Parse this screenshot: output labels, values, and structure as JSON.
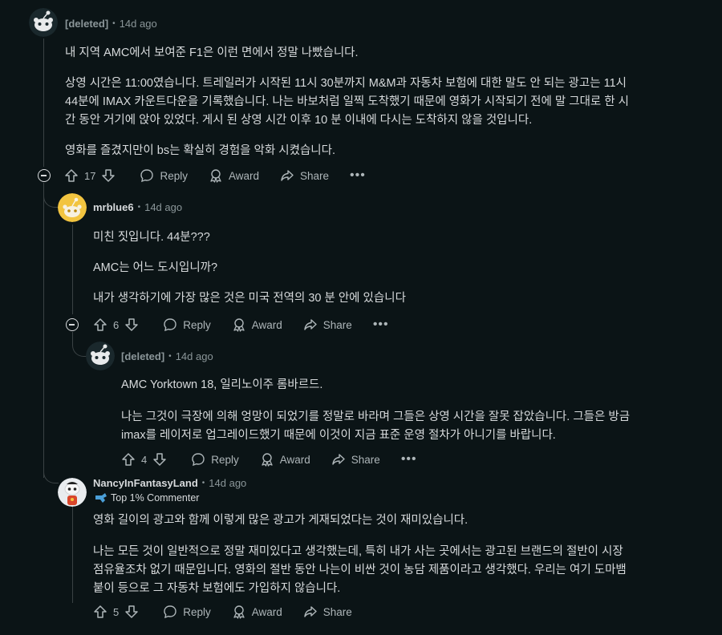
{
  "comments": [
    {
      "author": "[deleted]",
      "age": "14d ago",
      "paragraphs": [
        "내 지역 AMC에서 보여준 F1은 이런 면에서 정말 나빴습니다.",
        "상영 시간은 11:00였습니다. 트레일러가 시작된 11시 30분까지 M&M과 자동차 보험에 대한 말도 안 되는 광고는 11시",
        "44분에 IMAX 카운트다운을 기록했습니다. 나는 바보처럼 일찍 도착했기 때문에 영화가 시작되기 전에 말 그대로 한 시",
        "간 동안 거기에 앉아 있었다. 게시 된 상영 시간 이후 10 분 이내에 다시는 도착하지 않을 것입니다.",
        "영화를 즐겼지만이 bs는 확실히 경험을 악화 시켰습니다."
      ],
      "votes": "17"
    },
    {
      "author": "mrblue6",
      "age": "14d ago",
      "paragraphs": [
        "미친 짓입니다. 44분???",
        "AMC는 어느 도시입니까?",
        "내가 생각하기에 가장 많은 것은 미국 전역의 30 분 안에 있습니다"
      ],
      "votes": "6"
    },
    {
      "author": "[deleted]",
      "age": "14d ago",
      "paragraphs": [
        "AMC Yorktown 18, 일리노이주 롬바르드.",
        "나는 그것이 극장에 의해 엉망이 되었기를 정말로 바라며 그들은 상영 시간을 잘못 잡았습니다. 그들은 방금",
        "imax를 레이저로 업그레이드했기 때문에 이것이 지금 표준 운영 절차가 아니기를 바랍니다."
      ],
      "votes": "4"
    },
    {
      "author": "NancyInFantasyLand",
      "age": "14d ago",
      "badge": "Top 1% Commenter",
      "paragraphs": [
        "영화 길이의 광고와 함께 이렇게 많은 광고가 게재되었다는 것이 재미있습니다.",
        "나는 모든 것이 일반적으로 정말 재미있다고 생각했는데, 특히 내가 사는 곳에서는 광고된 브랜드의 절반이 시장",
        "점유율조차 없기 때문입니다. 영화의 절반 동안 나는이 비싼 것이 농담 제품이라고 생각했다. 우리는 여기 도마뱀",
        "붙이 등으로 그 자동차 보험에도 가입하지 않습니다."
      ],
      "votes": "5"
    }
  ],
  "actions": {
    "reply": "Reply",
    "award": "Award",
    "share": "Share",
    "more": "•••"
  },
  "colors": {
    "background": "#0b1416",
    "text": "#d7dadc",
    "muted": "#8b9699",
    "thread_line": "#3a4244",
    "avatar_yellow": "#f2c440"
  },
  "icons": [
    "snoo-avatar-icon",
    "upvote-icon",
    "downvote-icon",
    "reply-bubble-icon",
    "award-icon",
    "share-arrow-icon",
    "collapse-icon",
    "more-icon",
    "badge-icon"
  ]
}
